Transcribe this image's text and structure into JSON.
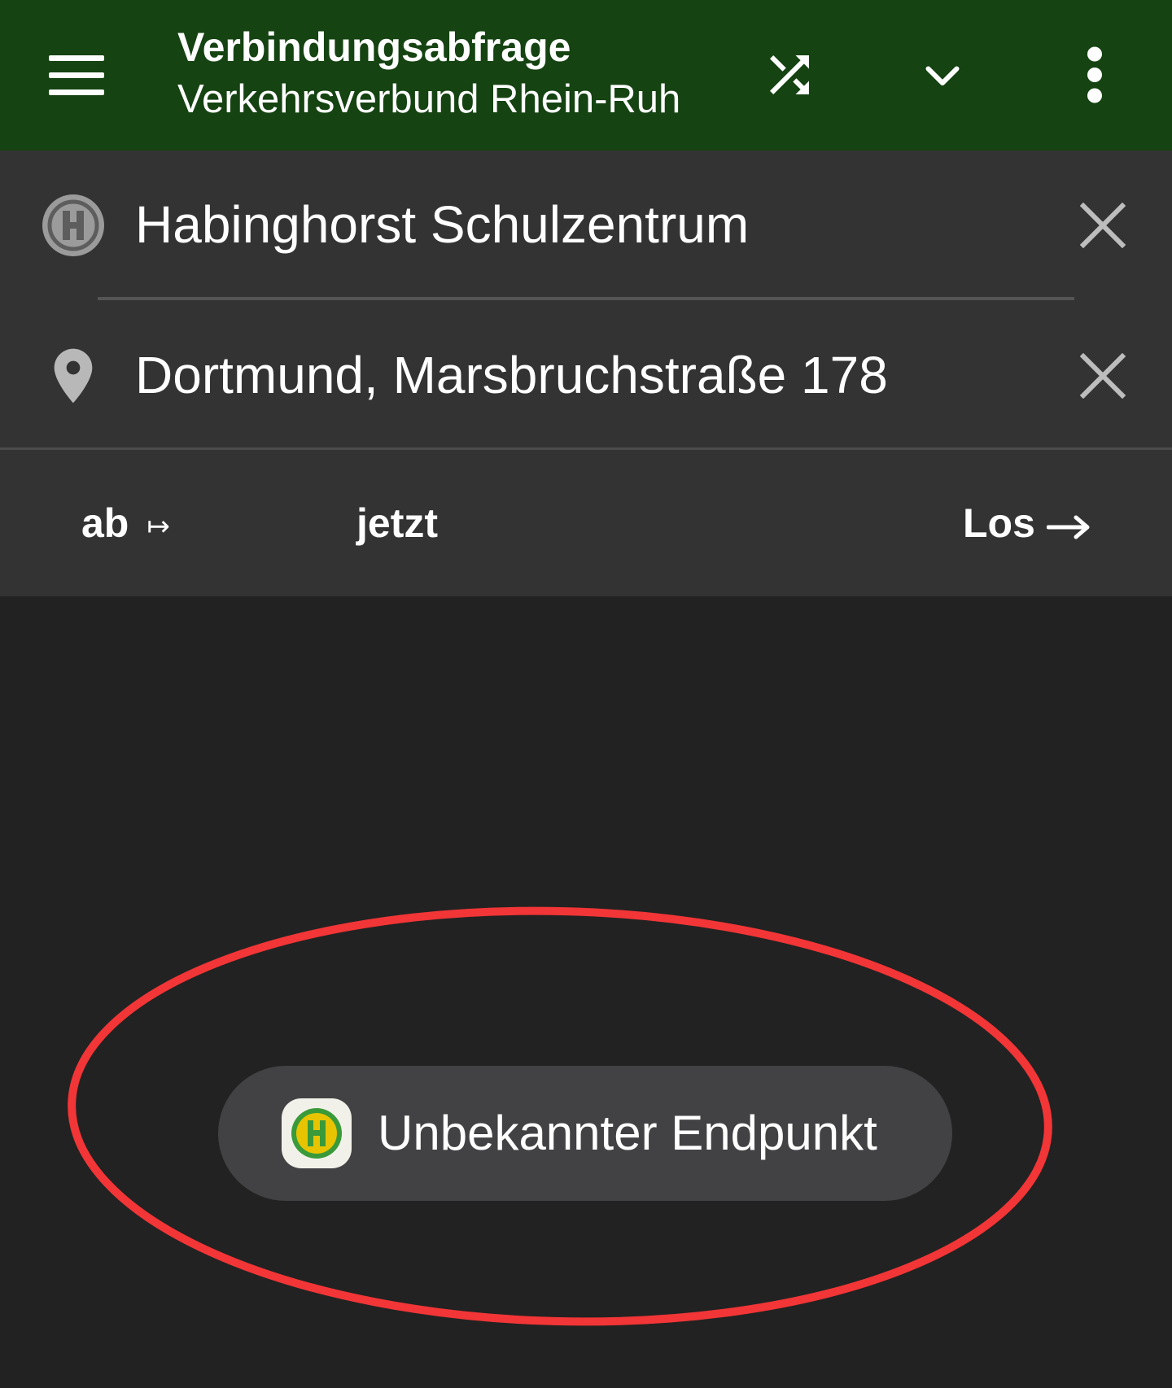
{
  "appbar": {
    "title": "Verbindungsabfrage",
    "subtitle": "Verkehrsverbund Rhein-Ruh",
    "background": "#154312",
    "icons": [
      "menu-icon",
      "shuffle-icon",
      "chevron-down-icon",
      "more-vert-icon"
    ]
  },
  "from": {
    "value": "Habinghorst Schulzentrum",
    "icon": "station-h-icon"
  },
  "to": {
    "value": "Dortmund, Marsbruchstraße 178",
    "icon": "location-pin-icon"
  },
  "options": {
    "departure_label": "ab",
    "departure_arrow": "↦",
    "time_label": "jetzt",
    "go_label": "Los"
  },
  "toast": {
    "message": "Unbekannter Endpunkt",
    "icon": "station-h-icon"
  },
  "colors": {
    "appbar": "#154312",
    "form_background": "#333333",
    "page_background": "#222222",
    "annotation": "#f23536",
    "toast_background": "#424244"
  }
}
